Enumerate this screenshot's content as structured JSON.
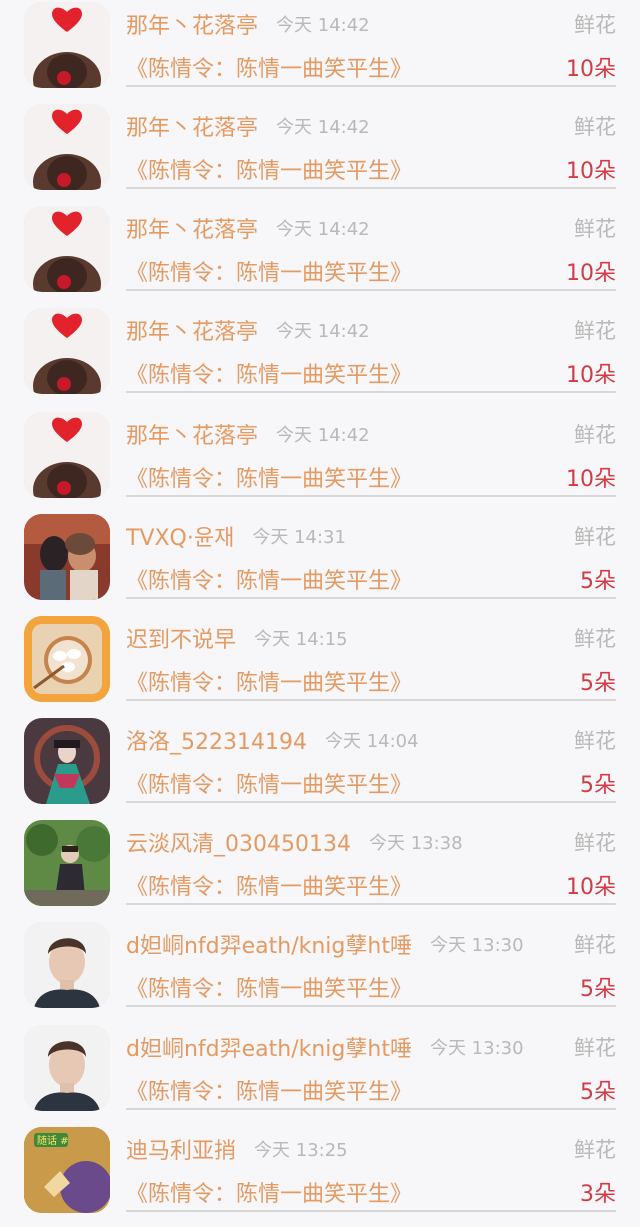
{
  "entries": [
    {
      "user": "那年丶花落亭",
      "time": "今天 14:42",
      "gift": "鲜花",
      "drama": "《陈情令：陈情一曲笑平生》",
      "count": "10朵",
      "avatar": "heart-girl"
    },
    {
      "user": "那年丶花落亭",
      "time": "今天 14:42",
      "gift": "鲜花",
      "drama": "《陈情令：陈情一曲笑平生》",
      "count": "10朵",
      "avatar": "heart-girl"
    },
    {
      "user": "那年丶花落亭",
      "time": "今天 14:42",
      "gift": "鲜花",
      "drama": "《陈情令：陈情一曲笑平生》",
      "count": "10朵",
      "avatar": "heart-girl"
    },
    {
      "user": "那年丶花落亭",
      "time": "今天 14:42",
      "gift": "鲜花",
      "drama": "《陈情令：陈情一曲笑平生》",
      "count": "10朵",
      "avatar": "heart-girl"
    },
    {
      "user": "那年丶花落亭",
      "time": "今天 14:42",
      "gift": "鲜花",
      "drama": "《陈情令：陈情一曲笑平生》",
      "count": "10朵",
      "avatar": "heart-girl"
    },
    {
      "user": "TVXQ·윤재",
      "time": "今天 14:31",
      "gift": "鲜花",
      "drama": "《陈情令：陈情一曲笑平生》",
      "count": "5朵",
      "avatar": "couple"
    },
    {
      "user": "迟到不说早",
      "time": "今天 14:15",
      "gift": "鲜花",
      "drama": "《陈情令：陈情一曲笑平生》",
      "count": "5朵",
      "avatar": "dumplings"
    },
    {
      "user": "洛洛_522314194",
      "time": "今天 14:04",
      "gift": "鲜花",
      "drama": "《陈情令：陈情一曲笑平生》",
      "count": "5朵",
      "avatar": "costume"
    },
    {
      "user": "云淡风清_030450134",
      "time": "今天 13:38",
      "gift": "鲜花",
      "drama": "《陈情令：陈情一曲笑平生》",
      "count": "10朵",
      "avatar": "garden"
    },
    {
      "user": "d妲峒nfd羿eath/knig孽ht唾",
      "time": "今天 13:30",
      "gift": "鲜花",
      "drama": "《陈情令：陈情一曲笑平生》",
      "count": "5朵",
      "avatar": "young-man"
    },
    {
      "user": "d妲峒nfd羿eath/knig孽ht唾",
      "time": "今天 13:30",
      "gift": "鲜花",
      "drama": "《陈情令：陈情一曲笑平生》",
      "count": "5朵",
      "avatar": "young-man"
    },
    {
      "user": "迪马利亚捎",
      "time": "今天 13:25",
      "gift": "鲜花",
      "drama": "《陈情令：陈情一曲笑平生》",
      "count": "3朵",
      "avatar": "sticker",
      "avatar_text": "随话 #"
    }
  ],
  "colors": {
    "username": "#e59a62",
    "timestamp": "#b9b9b9",
    "count": "#d33b45",
    "background": "#f7f6f8"
  }
}
